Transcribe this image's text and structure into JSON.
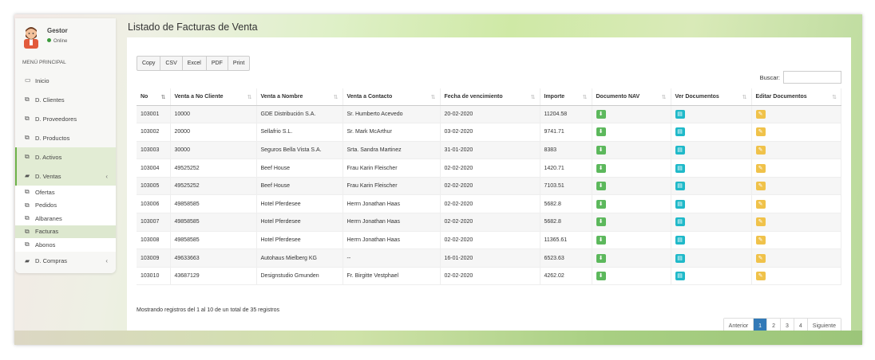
{
  "user": {
    "name": "Gestor",
    "status": "Online"
  },
  "menu_header": "MENÚ PRINCIPAL",
  "nav": [
    {
      "label": "Inicio",
      "icon": "monitor-icon"
    },
    {
      "label": "D. Clientes",
      "icon": "copy-icon"
    },
    {
      "label": "D. Proveedores",
      "icon": "copy-icon"
    },
    {
      "label": "D. Productos",
      "icon": "copy-icon"
    },
    {
      "label": "D. Activos",
      "icon": "copy-icon"
    },
    {
      "label": "D. Ventas",
      "icon": "folder-icon"
    }
  ],
  "ventas_sub": [
    {
      "label": "Ofertas"
    },
    {
      "label": "Pedidos"
    },
    {
      "label": "Albaranes"
    },
    {
      "label": "Facturas"
    },
    {
      "label": "Abonos"
    }
  ],
  "compras": {
    "label": "D. Compras",
    "icon": "folder-icon"
  },
  "page_title": "Listado de Facturas de Venta",
  "export_buttons": [
    "Copy",
    "CSV",
    "Excel",
    "PDF",
    "Print"
  ],
  "search": {
    "label": "Buscar:",
    "value": ""
  },
  "columns": [
    "No",
    "Venta a No Cliente",
    "Venta a Nombre",
    "Venta a Contacto",
    "Fecha de vencimiento",
    "Importe",
    "Documento NAV",
    "Ver Documentos",
    "Editar Documentos"
  ],
  "rows": [
    [
      "103001",
      "10000",
      "GDE Distribución S.A.",
      "Sr. Humberto Acevedo",
      "20-02-2020",
      "11204.58"
    ],
    [
      "103002",
      "20000",
      "Sellafrio S.L.",
      "Sr. Mark McArthur",
      "03-02-2020",
      "9741.71"
    ],
    [
      "103003",
      "30000",
      "Seguros Bella Vista S.A.",
      "Srta. Sandra Martinez",
      "31-01-2020",
      "8383"
    ],
    [
      "103004",
      "49525252",
      "Beef House",
      "Frau Karin Fleischer",
      "02-02-2020",
      "1420.71"
    ],
    [
      "103005",
      "49525252",
      "Beef House",
      "Frau Karin Fleischer",
      "02-02-2020",
      "7103.51"
    ],
    [
      "103006",
      "49858585",
      "Hotel Pferdesee",
      "Herrn Jonathan Haas",
      "02-02-2020",
      "5682.8"
    ],
    [
      "103007",
      "49858585",
      "Hotel Pferdesee",
      "Herrn Jonathan Haas",
      "02-02-2020",
      "5682.8"
    ],
    [
      "103008",
      "49858585",
      "Hotel Pferdesee",
      "Herrn Jonathan Haas",
      "02-02-2020",
      "11365.61"
    ],
    [
      "103009",
      "49633663",
      "Autohaus Mielberg KG",
      "--",
      "16-01-2020",
      "6523.63"
    ],
    [
      "103010",
      "43687129",
      "Designstudio Gmunden",
      "Fr. Birgitte Vestphael",
      "02-02-2020",
      "4262.02"
    ]
  ],
  "info_text": "Mostrando registros del 1 al 10 de un total de 35 registros",
  "pagination": {
    "prev": "Anterior",
    "pages": [
      "1",
      "2",
      "3",
      "4"
    ],
    "current": "1",
    "next": "Siguiente"
  },
  "colors": {
    "accent": "#6db24a",
    "pager_active": "#337ab7",
    "download_btn": "#5cb85c",
    "view_btn": "#1fb9c9",
    "edit_btn": "#f0c24a"
  }
}
